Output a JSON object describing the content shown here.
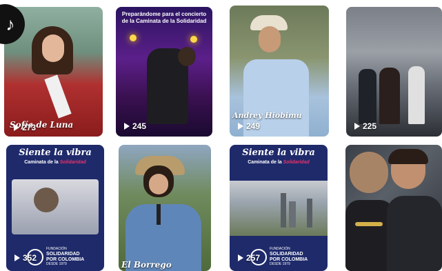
{
  "videos": [
    {
      "views": "273",
      "overlay_name": "Sofía de Luna",
      "overlay_sub": "Señorita Colombia"
    },
    {
      "views": "245",
      "caption_line1": "Preparándome para el concierto",
      "caption_line2": "de la Caminata de la Solidaridad"
    },
    {
      "views": "249",
      "overlay_name": "Andrey Hiobimu",
      "overlay_sub": "Cantante"
    },
    {
      "views": "225"
    },
    {
      "views": "352",
      "title": "Siente la vibra",
      "subtitle_prefix": "Caminata de la",
      "subtitle_accent": "Solidaridad",
      "foundation_small": "FUNDACIÓN",
      "foundation_line1": "SOLIDARIDAD",
      "foundation_line2": "POR COLOMBIA",
      "foundation_year": "DESDE 1979"
    },
    {
      "views": "",
      "overlay_name": "El Borrego"
    },
    {
      "views": "257",
      "title": "Siente la vibra",
      "subtitle_prefix": "Caminata de la",
      "subtitle_accent": "Solidaridad",
      "foundation_small": "FUNDACIÓN",
      "foundation_line1": "SOLIDARIDAD",
      "foundation_line2": "POR COLOMBIA",
      "foundation_year": "DESDE 1979"
    },
    {
      "views": ""
    }
  ],
  "colors": {
    "brand_navy": "#1f2a6b",
    "accent_pink": "#e8336b"
  },
  "icons": {
    "play": "play-icon",
    "logo": "tiktok-logo-icon"
  }
}
